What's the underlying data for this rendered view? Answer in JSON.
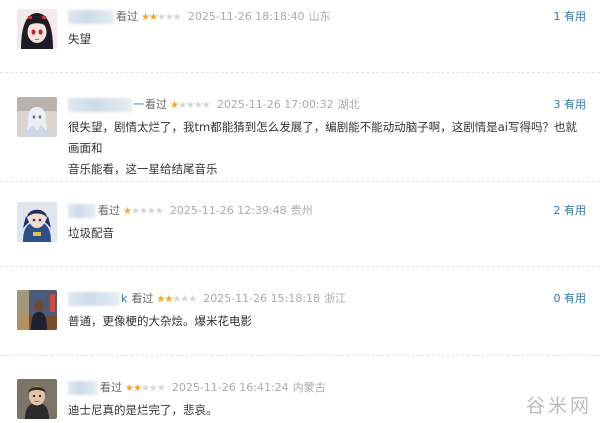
{
  "comments": [
    {
      "name_tail": "",
      "watched_label": "看过",
      "rating": 2,
      "time": "2025-11-26 18:18:40",
      "location": "山东",
      "useful": "1 有用",
      "text": [
        "失望"
      ]
    },
    {
      "name_tail": "一",
      "watched_label": "看过",
      "rating": 1,
      "time": "2025-11-26 17:00:32",
      "location": "湖北",
      "useful": "3 有用",
      "text": [
        "很失望，剧情太烂了，我tm都能猜到怎么发展了，编剧能不能动动脑子啊，这剧情是ai写得吗？也就画面和",
        "音乐能看，这一星给结尾音乐"
      ]
    },
    {
      "name_tail": "",
      "watched_label": "看过",
      "rating": 1,
      "time": "2025-11-26 12:39:48",
      "location": "贵州",
      "useful": "2 有用",
      "text": [
        "垃圾配音"
      ]
    },
    {
      "name_tail": "k",
      "watched_label": "看过",
      "rating": 2,
      "time": "2025-11-26 15:18:18",
      "location": "浙江",
      "useful": "0 有用",
      "text": [
        "普通，更像梗的大杂烩。爆米花电影"
      ]
    },
    {
      "name_tail": "",
      "watched_label": "看过",
      "rating": 2,
      "time": "2025-11-26 16:41:24",
      "location": "内蒙古",
      "useful": "",
      "text": [
        "迪士尼真的是烂完了，悲哀。"
      ]
    }
  ],
  "watermark": "谷米网",
  "colors": {
    "star_on": "#f5a623",
    "star_off": "#d6d6d6",
    "link": "#3377aa",
    "meta": "#999999"
  }
}
